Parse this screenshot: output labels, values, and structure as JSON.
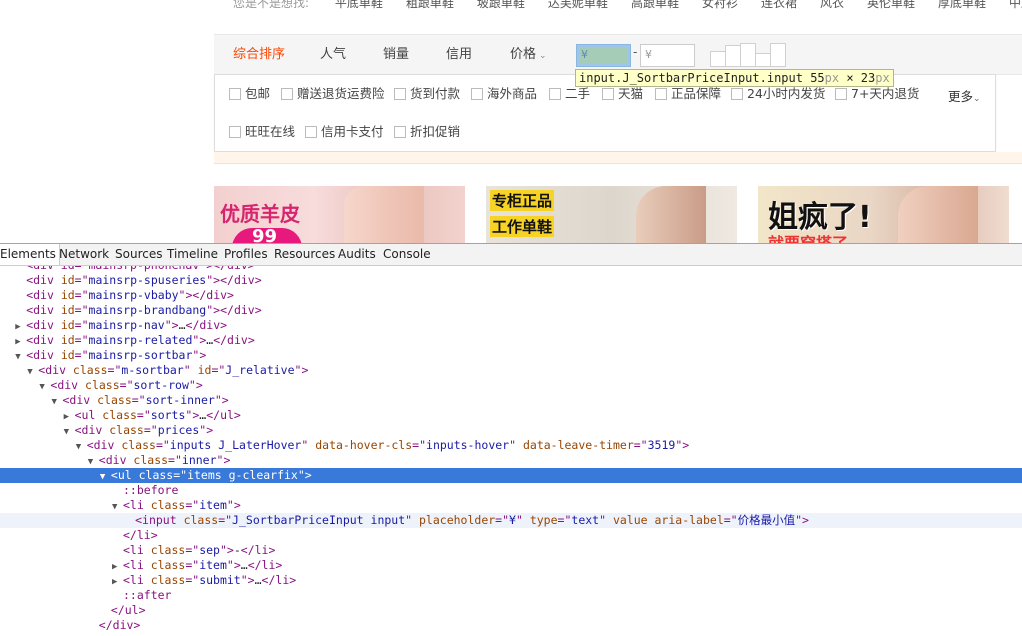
{
  "top": {
    "keywords_label": "您是不是想找:",
    "keywords": [
      "平底单鞋",
      "粗跟单鞋",
      "坡跟单鞋",
      "达芙妮单鞋",
      "高跟单鞋",
      "女衬衫",
      "连衣裙",
      "风衣",
      "英伦单鞋",
      "厚底单鞋",
      "中跟单鞋"
    ]
  },
  "sortbar": {
    "tabs": [
      {
        "label": "综合排序",
        "active": true
      },
      {
        "label": "人气",
        "active": false
      },
      {
        "label": "销量",
        "active": false
      },
      {
        "label": "信用",
        "active": false
      },
      {
        "label": "价格",
        "active": false,
        "caret": "⌄"
      }
    ],
    "price_min_placeholder": "¥",
    "price_sep": "-",
    "price_max_placeholder": "¥"
  },
  "tooltip": {
    "selector": "input.J_SortbarPriceInput.input",
    "width": "55",
    "unit1": "px",
    "times": " × ",
    "height": "23",
    "unit2": "px"
  },
  "filters": {
    "row1": [
      "包邮",
      "赠送退货运费险",
      "货到付款",
      "海外商品",
      "二手",
      "天猫",
      "正品保障",
      "24小时内发货",
      "7+天内退货"
    ],
    "row2": [
      "旺旺在线",
      "信用卡支付",
      "折扣促销"
    ],
    "more": "更多",
    "more_caret": "⌄"
  },
  "banners": {
    "b1_text": "优质羊皮",
    "b1_num": "99",
    "b2_line1": "专柜正品",
    "b2_line2": "工作单鞋",
    "b3_text": "姐疯了!",
    "b3_sub": "就要穿搭了"
  },
  "devtools": {
    "tabs": [
      "Elements",
      "Network",
      "Sources",
      "Timeline",
      "Profiles",
      "Resources",
      "Audits",
      "Console"
    ],
    "active_tab": "Elements",
    "lines": [
      {
        "indent": 2,
        "tri": "",
        "html": "<div id=\"mainsrp-phonenav\"></div>",
        "state": "clipped"
      },
      {
        "indent": 2,
        "tri": "",
        "tag_open": "div",
        "attrs": [
          [
            "id",
            "mainsrp-spuseries"
          ]
        ],
        "close": "</div>"
      },
      {
        "indent": 2,
        "tri": "",
        "tag_open": "div",
        "attrs": [
          [
            "id",
            "mainsrp-vbaby"
          ]
        ],
        "close": "</div>"
      },
      {
        "indent": 2,
        "tri": "",
        "tag_open": "div",
        "attrs": [
          [
            "id",
            "mainsrp-brandbang"
          ]
        ],
        "close": "</div>"
      },
      {
        "indent": 2,
        "tri": "▶",
        "tag_open": "div",
        "attrs": [
          [
            "id",
            "mainsrp-nav"
          ]
        ],
        "close": "…</div>"
      },
      {
        "indent": 2,
        "tri": "▶",
        "tag_open": "div",
        "attrs": [
          [
            "id",
            "mainsrp-related"
          ]
        ],
        "close": "…</div>"
      },
      {
        "indent": 2,
        "tri": "▼",
        "tag_open": "div",
        "attrs": [
          [
            "id",
            "mainsrp-sortbar"
          ]
        ],
        "close": ""
      },
      {
        "indent": 3,
        "tri": "▼",
        "tag_open": "div",
        "attrs": [
          [
            "class",
            "m-sortbar"
          ],
          [
            "id",
            "J_relative"
          ]
        ],
        "close": ""
      },
      {
        "indent": 4,
        "tri": "▼",
        "tag_open": "div",
        "attrs": [
          [
            "class",
            "sort-row"
          ]
        ],
        "close": ""
      },
      {
        "indent": 5,
        "tri": "▼",
        "tag_open": "div",
        "attrs": [
          [
            "class",
            "sort-inner"
          ]
        ],
        "close": ""
      },
      {
        "indent": 6,
        "tri": "▶",
        "tag_open": "ul",
        "attrs": [
          [
            "class",
            "sorts"
          ]
        ],
        "close": "…</ul>"
      },
      {
        "indent": 6,
        "tri": "▼",
        "tag_open": "div",
        "attrs": [
          [
            "class",
            "prices"
          ]
        ],
        "close": ""
      },
      {
        "indent": 7,
        "tri": "▼",
        "tag_open": "div",
        "attrs": [
          [
            "class",
            "inputs J_LaterHover"
          ],
          [
            "data-hover-cls",
            "inputs-hover"
          ],
          [
            "data-leave-timer",
            "3519"
          ]
        ],
        "close": ""
      },
      {
        "indent": 8,
        "tri": "▼",
        "tag_open": "div",
        "attrs": [
          [
            "class",
            "inner"
          ]
        ],
        "close": ""
      },
      {
        "indent": 9,
        "tri": "▼",
        "tag_open": "ul",
        "attrs": [
          [
            "class",
            "items g-clearfix"
          ]
        ],
        "close": "",
        "state": "selected"
      },
      {
        "indent": 10,
        "tri": "",
        "pseudo": "::before"
      },
      {
        "indent": 10,
        "tri": "▼",
        "tag_open": "li",
        "attrs": [
          [
            "class",
            "item"
          ]
        ],
        "close": ""
      },
      {
        "indent": 11,
        "tri": "",
        "tag_open": "input",
        "attrs": [
          [
            "class",
            "J_SortbarPriceInput input"
          ],
          [
            "placeholder",
            "¥"
          ],
          [
            "type",
            "text"
          ],
          [
            "value",
            null
          ],
          [
            "aria-label",
            "价格最小值"
          ]
        ],
        "close": "",
        "state": "hover"
      },
      {
        "indent": 10,
        "tri": "",
        "end_tag": "</li>"
      },
      {
        "indent": 10,
        "tri": "",
        "tag_open": "li",
        "attrs": [
          [
            "class",
            "sep"
          ]
        ],
        "close": "-</li>",
        "close_text": "-"
      },
      {
        "indent": 10,
        "tri": "▶",
        "tag_open": "li",
        "attrs": [
          [
            "class",
            "item"
          ]
        ],
        "close": "…</li>"
      },
      {
        "indent": 10,
        "tri": "▶",
        "tag_open": "li",
        "attrs": [
          [
            "class",
            "submit"
          ]
        ],
        "close": "…</li>"
      },
      {
        "indent": 10,
        "tri": "",
        "pseudo": "::after"
      },
      {
        "indent": 9,
        "tri": "",
        "end_tag": "</ul>"
      },
      {
        "indent": 8,
        "tri": "",
        "end_tag": "</div>"
      }
    ]
  }
}
